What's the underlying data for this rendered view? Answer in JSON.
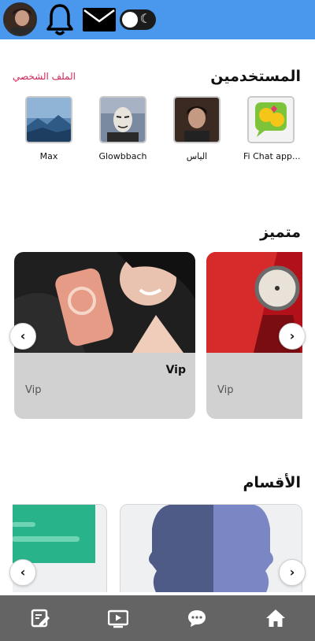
{
  "header": {
    "avatar_icon": "user-avatar",
    "notification_icon": "bell-icon",
    "messages_icon": "mail-icon",
    "theme_toggle_icon": "moon-icon",
    "accent_color": "#4a97ee"
  },
  "users_section": {
    "title": "المستخدمين",
    "profile_link": "الملف الشخصي",
    "users": [
      {
        "name": "Fi Chat app..."
      },
      {
        "name": "الياس"
      },
      {
        "name": "Glowbbach"
      },
      {
        "name": "Max"
      }
    ]
  },
  "featured_section": {
    "title": "متميز",
    "cards": [
      {
        "title": "Vip",
        "subtitle": "Vip"
      },
      {
        "title": "",
        "subtitle": "Vip"
      }
    ],
    "prev_label": "‹",
    "next_label": "›"
  },
  "categories_section": {
    "title": "الأقسام",
    "prev_label": "‹",
    "next_label": "›"
  },
  "bottom_nav": {
    "items": [
      {
        "icon": "edit-icon"
      },
      {
        "icon": "video-icon"
      },
      {
        "icon": "chat-icon"
      },
      {
        "icon": "home-icon"
      }
    ],
    "background": "#646464"
  }
}
